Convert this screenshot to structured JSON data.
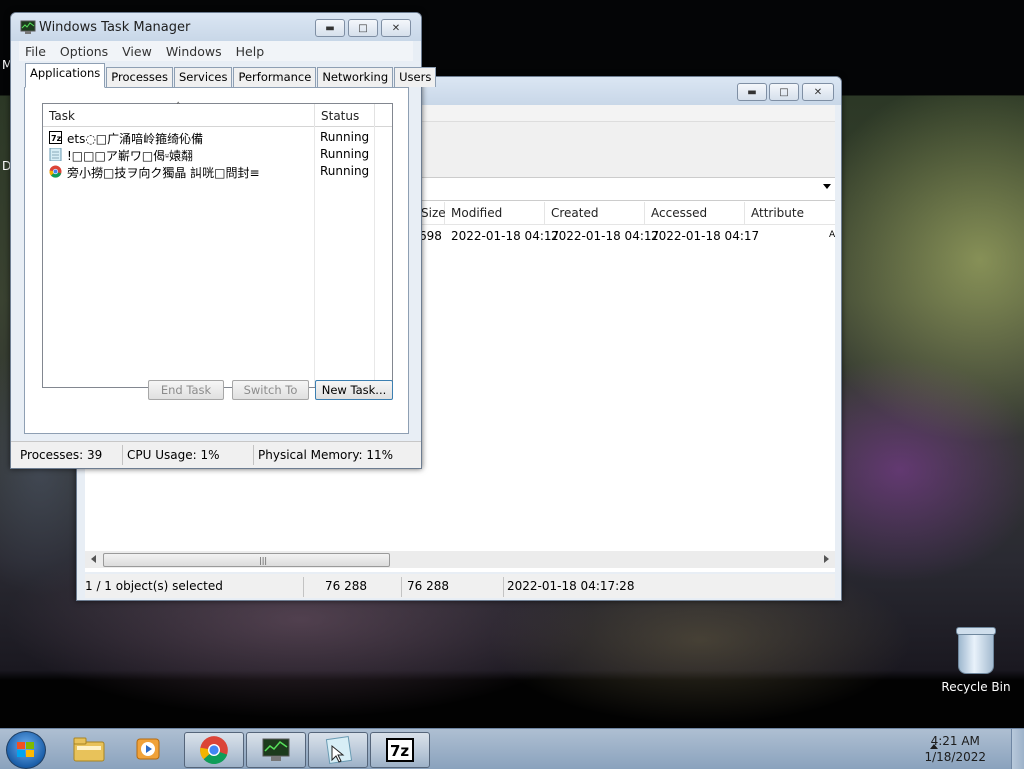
{
  "desktop": {
    "left_label_1": "M",
    "left_label_2": "D",
    "recycle_bin_label": "Recycle Bin"
  },
  "file_manager": {
    "columns": [
      "Size",
      "Modified",
      "Created",
      "Accessed",
      "Attribute"
    ],
    "row": {
      "size": "698",
      "modified": "2022-01-18 04:17",
      "created": "2022-01-18 04:17",
      "accessed": "2022-01-18 04:17",
      "attributes": "A"
    },
    "status": {
      "selected": "1 / 1 object(s) selected",
      "size": "76 288",
      "packed": "76 288",
      "modified": "2022-01-18 04:17:28"
    }
  },
  "task_manager": {
    "title": "Windows Task Manager",
    "menu": [
      "File",
      "Options",
      "View",
      "Windows",
      "Help"
    ],
    "tabs": [
      "Applications",
      "Processes",
      "Services",
      "Performance",
      "Networking",
      "Users"
    ],
    "active_tab": "Applications",
    "columns": {
      "task": "Task",
      "status": "Status"
    },
    "tasks": [
      {
        "name": "ets◌□广涌喑岭箍绮伈備",
        "status": "Running",
        "icon": "7zip-icon"
      },
      {
        "name": "!□□□ア嶄ワ□偈⸚媴翷",
        "status": "Running",
        "icon": "notepad-icon"
      },
      {
        "name": "旁小撈□技ヲ向ク獨晶 訆咣□問封≡",
        "status": "Running",
        "icon": "chrome-icon"
      }
    ],
    "buttons": {
      "end_task": "End Task",
      "switch_to": "Switch To",
      "new_task": "New Task..."
    },
    "status": {
      "processes": "Processes: 39",
      "cpu": "CPU Usage: 1%",
      "memory": "Physical Memory: 11%"
    }
  },
  "taskbar": {
    "pinned": [
      "start-button",
      "explorer-icon",
      "media-player-icon",
      "chrome-icon",
      "task-manager-icon",
      "notepad-icon",
      "7zip-icon"
    ],
    "clock_time": "4:21 AM",
    "clock_date": "1/18/2022"
  },
  "colors": {
    "taskbar": "#9db2c9",
    "window_frame": "#dbe6f3",
    "accent_button_border": "#3c7fb1"
  }
}
